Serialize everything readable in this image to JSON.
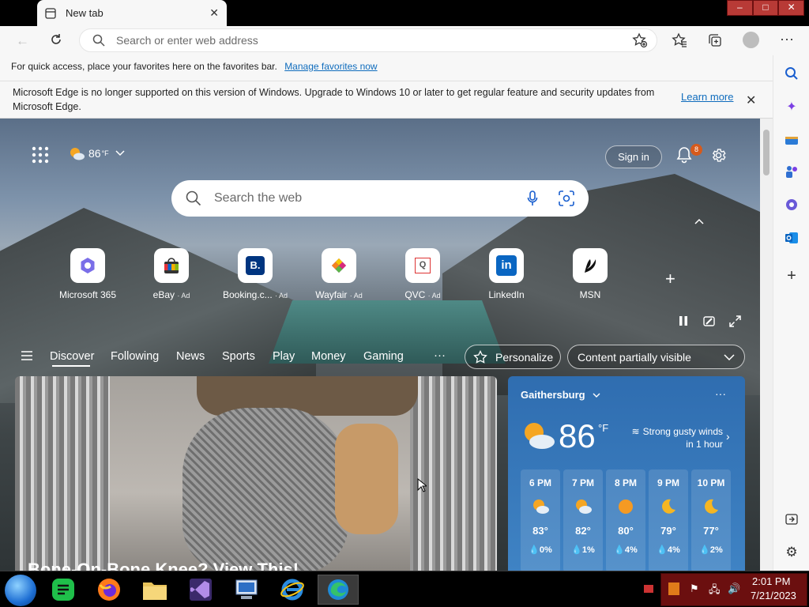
{
  "tab": {
    "title": "New tab"
  },
  "window": {
    "controls": [
      "–",
      "□",
      "✕"
    ]
  },
  "address_bar": {
    "placeholder": "Search or enter web address"
  },
  "favorites_bar": {
    "text": "For quick access, place your favorites here on the favorites bar.",
    "link": "Manage favorites now"
  },
  "info_bar": {
    "text": "Microsoft Edge is no longer supported on this version of Windows. Upgrade to Windows 10 or later to get regular feature and security updates from Microsoft Edge.",
    "learn_more": "Learn more"
  },
  "header": {
    "weather_temp": "86",
    "weather_unit": "°F",
    "sign_in": "Sign in",
    "notification_count": "8"
  },
  "search": {
    "placeholder": "Search the web"
  },
  "tiles": [
    {
      "label": "Microsoft 365",
      "ad": "",
      "icon": "microsoft-365-icon"
    },
    {
      "label": "eBay",
      "ad": "· Ad",
      "icon": "ebay-icon"
    },
    {
      "label": "Booking.c...",
      "ad": "· Ad",
      "icon": "booking-icon"
    },
    {
      "label": "Wayfair",
      "ad": "· Ad",
      "icon": "wayfair-icon"
    },
    {
      "label": "QVC",
      "ad": "· Ad",
      "icon": "qvc-icon"
    },
    {
      "label": "LinkedIn",
      "ad": "",
      "icon": "linkedin-icon"
    },
    {
      "label": "MSN",
      "ad": "",
      "icon": "msn-icon"
    }
  ],
  "tile_glyphs": {
    "booking": "B.",
    "linkedin": "in",
    "qvc": "Q"
  },
  "nav": {
    "items": [
      "Discover",
      "Following",
      "News",
      "Sports",
      "Play",
      "Money",
      "Gaming"
    ],
    "more": "···",
    "personalize": "Personalize",
    "content_visibility": "Content partially visible"
  },
  "news": {
    "headline": "Bone-On-Bone Knee? View This!"
  },
  "weather": {
    "city": "Gaithersburg",
    "temp": "86",
    "unit": "°F",
    "alert": "Strong gusty winds in 1 hour",
    "hourly": [
      {
        "time": "6 PM",
        "temp": "83°",
        "precip": "0%",
        "icon": "partly-sunny-icon"
      },
      {
        "time": "7 PM",
        "temp": "82°",
        "precip": "1%",
        "icon": "partly-sunny-icon"
      },
      {
        "time": "8 PM",
        "temp": "80°",
        "precip": "4%",
        "icon": "sun-icon"
      },
      {
        "time": "9 PM",
        "temp": "79°",
        "precip": "4%",
        "icon": "moon-icon"
      },
      {
        "time": "10 PM",
        "temp": "77°",
        "precip": "2%",
        "icon": "moon-icon"
      }
    ]
  },
  "taskbar": {
    "time": "2:01 PM",
    "date": "7/21/2023"
  },
  "colors": {
    "accent": "#0f6cbd",
    "weather_card": "#2f6db0",
    "badge": "#d65a1c"
  }
}
